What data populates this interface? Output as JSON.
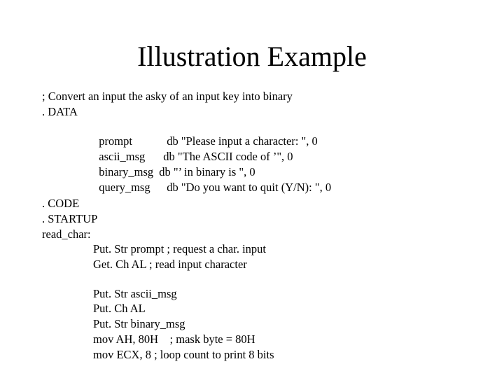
{
  "title": "Illustration Example",
  "lines": {
    "comment": "; Convert an input the asky of an input key into binary",
    "data_directive": ". DATA",
    "data_defs": [
      {
        "name": "prompt",
        "def": "db \"Please input a character: \", 0"
      },
      {
        "name": "ascii_msg",
        "def": "db \"The ASCII code of ’\", 0"
      },
      {
        "name": "binary_msg",
        "def": "db \"’ in binary is \", 0"
      },
      {
        "name": "query_msg",
        "def": "db \"Do you want to quit (Y/N): \", 0"
      }
    ],
    "code_directive": ". CODE",
    "startup_directive": ". STARTUP",
    "label_read_char": "read_char:",
    "instructions_1": [
      "Put. Str prompt ; request a char. input",
      "Get. Ch AL ; read input character"
    ],
    "instructions_2": [
      "Put. Str ascii_msg",
      "Put. Ch AL",
      "Put. Str binary_msg",
      "mov AH, 80H    ; mask byte = 80H",
      "mov ECX, 8 ; loop count to print 8 bits"
    ]
  }
}
